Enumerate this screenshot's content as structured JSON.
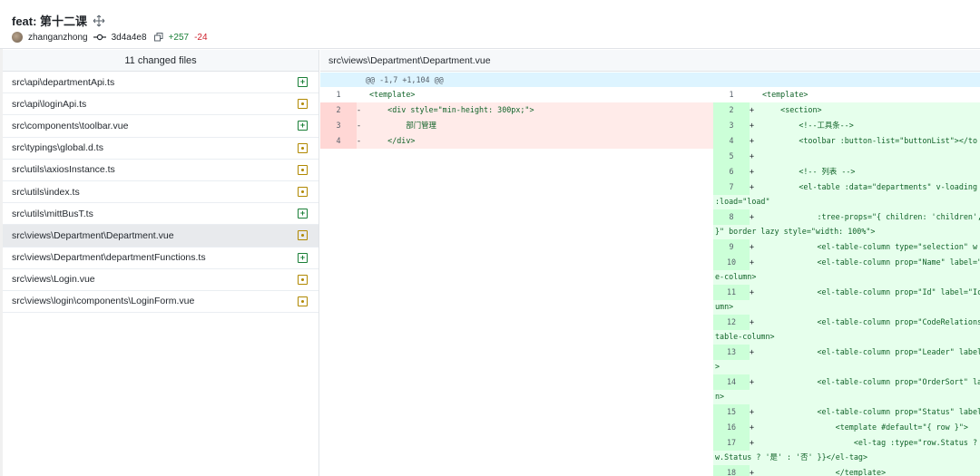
{
  "commit": {
    "title": "feat: 第十二课",
    "author": "zhanganzhong",
    "sha": "3d4a4e8",
    "additions": "+257",
    "deletions": "-24",
    "icons": [
      "move-icon",
      "avatar",
      "commit-icon",
      "copy-icon"
    ]
  },
  "files": {
    "header": "11 changed files",
    "items": [
      {
        "path": "src\\api\\departmentApi.ts",
        "status": "added"
      },
      {
        "path": "src\\api\\loginApi.ts",
        "status": "modified"
      },
      {
        "path": "src\\components\\toolbar.vue",
        "status": "added"
      },
      {
        "path": "src\\typings\\global.d.ts",
        "status": "modified"
      },
      {
        "path": "src\\utils\\axiosInstance.ts",
        "status": "modified"
      },
      {
        "path": "src\\utils\\index.ts",
        "status": "modified"
      },
      {
        "path": "src\\utils\\mittBusT.ts",
        "status": "added"
      },
      {
        "path": "src\\views\\Department\\Department.vue",
        "status": "modified",
        "selected": true
      },
      {
        "path": "src\\views\\Department\\departmentFunctions.ts",
        "status": "added"
      },
      {
        "path": "src\\views\\Login.vue",
        "status": "modified"
      },
      {
        "path": "src\\views\\login\\components\\LoginForm.vue",
        "status": "modified"
      }
    ]
  },
  "diff": {
    "path": "src\\views\\Department\\Department.vue",
    "hunk": "@@ -1,7 +1,104 @@",
    "old_lines": [
      {
        "num": "1",
        "sign": "",
        "code": "<template>",
        "type": "context"
      },
      {
        "num": "2",
        "sign": "-",
        "code": "    <div style=\"min-height: 300px;\">",
        "type": "del"
      },
      {
        "num": "3",
        "sign": "-",
        "code": "        部门管理",
        "type": "del"
      },
      {
        "num": "4",
        "sign": "-",
        "code": "    </div>",
        "type": "del"
      }
    ],
    "new_lines": [
      {
        "num": "1",
        "sign": "",
        "code": "<template>",
        "wrap": "",
        "type": "context"
      },
      {
        "num": "2",
        "sign": "+",
        "code": "    <section>",
        "wrap": "",
        "type": "add"
      },
      {
        "num": "3",
        "sign": "+",
        "code": "        <!--工具条-->",
        "wrap": "",
        "type": "add"
      },
      {
        "num": "4",
        "sign": "+",
        "code": "        <toolbar :button-list=\"buttonList\"></to",
        "wrap": "",
        "type": "add"
      },
      {
        "num": "5",
        "sign": "+",
        "code": "",
        "wrap": "",
        "type": "add"
      },
      {
        "num": "6",
        "sign": "+",
        "code": "        <!-- 列表 -->",
        "wrap": "",
        "type": "add"
      },
      {
        "num": "7",
        "sign": "+",
        "code": "        <el-table :data=\"departments\" v-loading",
        "wrap": ":load=\"load\"",
        "type": "add"
      },
      {
        "num": "8",
        "sign": "+",
        "code": "            :tree-props=\"{ children: 'children',",
        "wrap": "}\" border lazy style=\"width: 100%\">",
        "type": "add"
      },
      {
        "num": "9",
        "sign": "+",
        "code": "            <el-table-column type=\"selection\" w",
        "wrap": "",
        "type": "add"
      },
      {
        "num": "10",
        "sign": "+",
        "code": "            <el-table-column prop=\"Name\" label=\"",
        "wrap": "e-column>",
        "type": "add"
      },
      {
        "num": "11",
        "sign": "+",
        "code": "            <el-table-column prop=\"Id\" label=\"Ic",
        "wrap": "umn>",
        "type": "add"
      },
      {
        "num": "12",
        "sign": "+",
        "code": "            <el-table-column prop=\"CodeRelations",
        "wrap": "table-column>",
        "type": "add"
      },
      {
        "num": "13",
        "sign": "+",
        "code": "            <el-table-column prop=\"Leader\" label",
        "wrap": ">",
        "type": "add"
      },
      {
        "num": "14",
        "sign": "+",
        "code": "            <el-table-column prop=\"OrderSort\" la",
        "wrap": "n>",
        "type": "add"
      },
      {
        "num": "15",
        "sign": "+",
        "code": "            <el-table-column prop=\"Status\" label",
        "wrap": "",
        "type": "add"
      },
      {
        "num": "16",
        "sign": "+",
        "code": "                <template #default=\"{ row }\">",
        "wrap": "",
        "type": "add"
      },
      {
        "num": "17",
        "sign": "+",
        "code": "                    <el-tag :type=\"row.Status ?",
        "wrap": "w.Status ? '是' : '否' }}</el-tag>",
        "type": "add"
      },
      {
        "num": "18",
        "sign": "+",
        "code": "                </template>",
        "wrap": "",
        "type": "add"
      }
    ]
  },
  "colors": {
    "added": "#1a7f37",
    "deleted": "#cf222e",
    "modified": "#b08800",
    "add_bg": "#e6ffec",
    "del_bg": "#ffebe9",
    "hunk_bg": "#ddf4ff"
  }
}
